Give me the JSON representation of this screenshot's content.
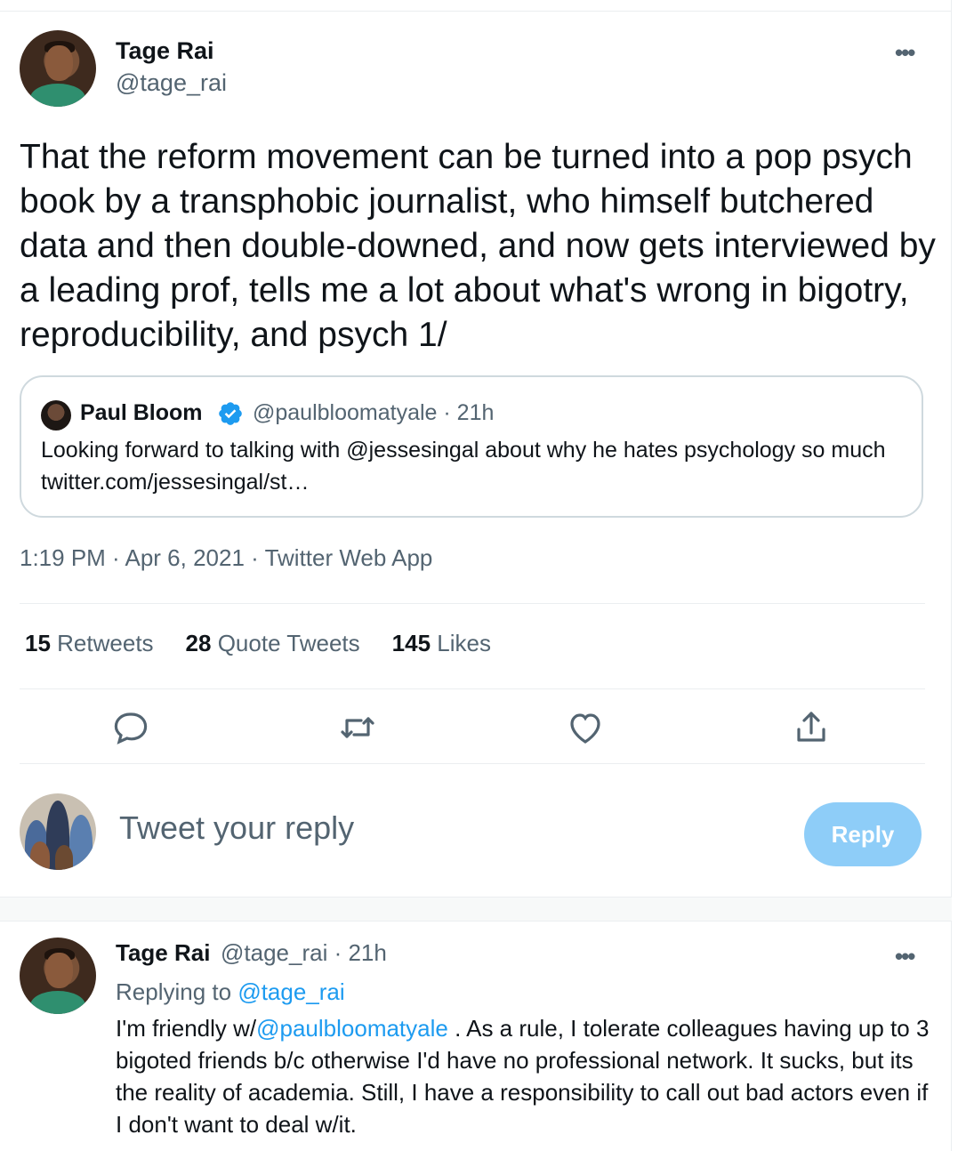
{
  "main_tweet": {
    "author_name": "Tage Rai",
    "author_handle": "@tage_rai",
    "text": "That the reform movement can be turned into a pop psych book by a transphobic journalist, who himself butchered data and then double-downed, and now gets interviewed by a leading prof, tells me a lot about what's wrong in bigotry, reproducibility, and psych 1/",
    "more_label": "•••",
    "timestamp": "1:19 PM · Apr 6, 2021 · Twitter Web App"
  },
  "quoted_tweet": {
    "author_name": "Paul Bloom",
    "meta": "@paulbloomatyale · 21h",
    "text": "Looking forward to talking with @jessesingal about why he hates psychology so much twitter.com/jessesingal/st…"
  },
  "stats": [
    {
      "count": "15",
      "label": "Retweets"
    },
    {
      "count": "28",
      "label": "Quote Tweets"
    },
    {
      "count": "145",
      "label": "Likes"
    }
  ],
  "composer": {
    "placeholder": "Tweet your reply",
    "button_label": "Reply"
  },
  "reply_tweet": {
    "author_name": "Tage Rai",
    "meta": "@tage_rai · 21h",
    "replying_prefix": "Replying to",
    "replying_mention": "@tage_rai",
    "text_prefix": "I'm friendly w/",
    "text_mention": "@paulbloomatyale",
    "text_rest": " . As a rule, I tolerate colleagues having up to  3 bigoted friends b/c otherwise I'd have no professional network. It sucks, but its the reality of academia. Still, I have a  responsibility to call out bad actors even if I don't want to deal w/it.",
    "more_label": "•••"
  },
  "colors": {
    "accent": "#1d9bf0",
    "reply_button_disabled": "#8ecdf8",
    "secondary_text": "#536471",
    "border": "#cfd9de"
  },
  "icons": {
    "reply": "reply-icon",
    "retweet": "retweet-icon",
    "like": "heart-icon",
    "share": "share-icon",
    "more": "more-icon",
    "verified": "verified-badge-icon"
  }
}
